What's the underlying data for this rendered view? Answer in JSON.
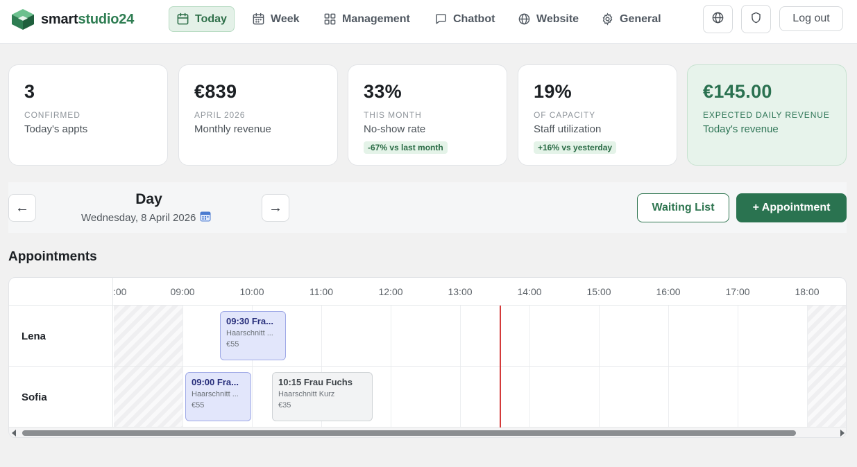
{
  "brand": {
    "name_part1": "smart",
    "name_part2": "studio24",
    "logo_icon": "cube-logo-icon"
  },
  "nav": [
    {
      "label": "Today",
      "icon": "calendar-icon",
      "active": true
    },
    {
      "label": "Week",
      "icon": "calendar-grid-icon",
      "active": false
    },
    {
      "label": "Management",
      "icon": "grid-icon",
      "active": false
    },
    {
      "label": "Chatbot",
      "icon": "chat-bubble-icon",
      "active": false
    },
    {
      "label": "Website",
      "icon": "globe-icon",
      "active": false
    },
    {
      "label": "General",
      "icon": "gear-icon",
      "active": false
    }
  ],
  "header": {
    "logout_label": "Log out"
  },
  "stats": [
    {
      "value": "3",
      "caption": "CONFIRMED",
      "subtitle": "Today's appts",
      "chip": ""
    },
    {
      "value": "€839",
      "caption": "APRIL 2026",
      "subtitle": "Monthly revenue",
      "chip": ""
    },
    {
      "value": "33%",
      "caption": "THIS MONTH",
      "subtitle": "No-show rate",
      "chip": "-67% vs last month"
    },
    {
      "value": "19%",
      "caption": "OF CAPACITY",
      "subtitle": "Staff utilization",
      "chip": "+16% vs yesterday"
    },
    {
      "value": "€145.00",
      "caption": "EXPECTED DAILY REVENUE",
      "subtitle": "Today's revenue",
      "chip": ""
    }
  ],
  "day": {
    "prev_label": "←",
    "next_label": "→",
    "title": "Day",
    "date": "Wednesday, 8 April 2026",
    "waiting_list_label": "Waiting List",
    "add_appointment_label": "+ Appointment"
  },
  "appointments_title": "Appointments",
  "timeline": {
    "first_label_clipped": ":00",
    "hours": [
      "09:00",
      "10:00",
      "11:00",
      "12:00",
      "13:00",
      "14:00",
      "15:00",
      "16:00",
      "17:00",
      "18:00"
    ],
    "staff": [
      {
        "name": "Lena",
        "appointments": [
          {
            "title": "09:30 Fra...",
            "service": "Haarschnitt ...",
            "price": "€55",
            "status": "confirmed"
          }
        ]
      },
      {
        "name": "Sofia",
        "appointments": [
          {
            "title": "09:00 Fra...",
            "service": "Haarschnitt ...",
            "price": "€55",
            "status": "confirmed"
          },
          {
            "title": "10:15 Frau Fuchs",
            "service": "Haarschnitt Kurz",
            "price": "€35",
            "status": "pending"
          }
        ]
      }
    ]
  },
  "colors": {
    "brand_green": "#2e7d52",
    "primary_button": "#2a7350",
    "appointment_confirmed": "#e2e6fb",
    "appointment_pending": "#f2f3f4",
    "now_line": "#d43a3a"
  }
}
